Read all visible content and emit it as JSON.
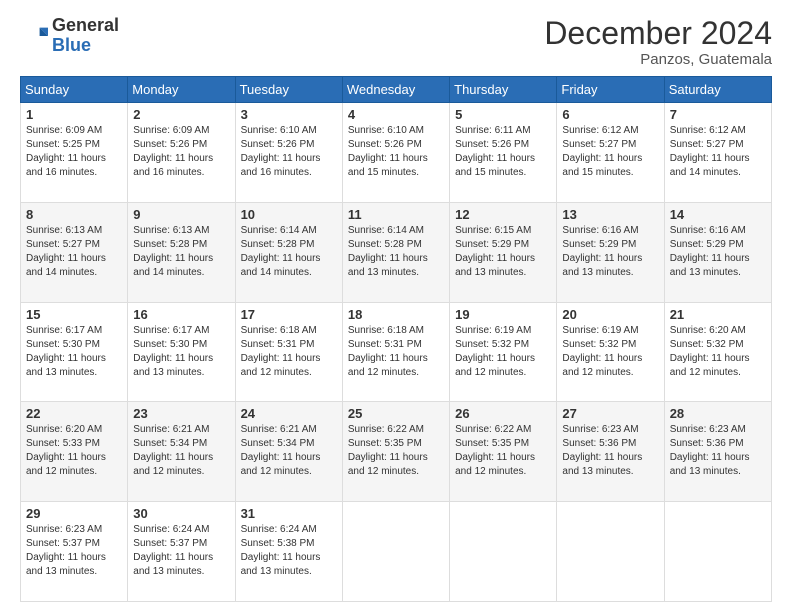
{
  "logo": {
    "general": "General",
    "blue": "Blue"
  },
  "title": "December 2024",
  "subtitle": "Panzos, Guatemala",
  "days_of_week": [
    "Sunday",
    "Monday",
    "Tuesday",
    "Wednesday",
    "Thursday",
    "Friday",
    "Saturday"
  ],
  "weeks": [
    [
      {
        "day": "1",
        "sunrise": "6:09 AM",
        "sunset": "5:25 PM",
        "daylight": "11 hours and 16 minutes."
      },
      {
        "day": "2",
        "sunrise": "6:09 AM",
        "sunset": "5:26 PM",
        "daylight": "11 hours and 16 minutes."
      },
      {
        "day": "3",
        "sunrise": "6:10 AM",
        "sunset": "5:26 PM",
        "daylight": "11 hours and 16 minutes."
      },
      {
        "day": "4",
        "sunrise": "6:10 AM",
        "sunset": "5:26 PM",
        "daylight": "11 hours and 15 minutes."
      },
      {
        "day": "5",
        "sunrise": "6:11 AM",
        "sunset": "5:26 PM",
        "daylight": "11 hours and 15 minutes."
      },
      {
        "day": "6",
        "sunrise": "6:12 AM",
        "sunset": "5:27 PM",
        "daylight": "11 hours and 15 minutes."
      },
      {
        "day": "7",
        "sunrise": "6:12 AM",
        "sunset": "5:27 PM",
        "daylight": "11 hours and 14 minutes."
      }
    ],
    [
      {
        "day": "8",
        "sunrise": "6:13 AM",
        "sunset": "5:27 PM",
        "daylight": "11 hours and 14 minutes."
      },
      {
        "day": "9",
        "sunrise": "6:13 AM",
        "sunset": "5:28 PM",
        "daylight": "11 hours and 14 minutes."
      },
      {
        "day": "10",
        "sunrise": "6:14 AM",
        "sunset": "5:28 PM",
        "daylight": "11 hours and 14 minutes."
      },
      {
        "day": "11",
        "sunrise": "6:14 AM",
        "sunset": "5:28 PM",
        "daylight": "11 hours and 13 minutes."
      },
      {
        "day": "12",
        "sunrise": "6:15 AM",
        "sunset": "5:29 PM",
        "daylight": "11 hours and 13 minutes."
      },
      {
        "day": "13",
        "sunrise": "6:16 AM",
        "sunset": "5:29 PM",
        "daylight": "11 hours and 13 minutes."
      },
      {
        "day": "14",
        "sunrise": "6:16 AM",
        "sunset": "5:29 PM",
        "daylight": "11 hours and 13 minutes."
      }
    ],
    [
      {
        "day": "15",
        "sunrise": "6:17 AM",
        "sunset": "5:30 PM",
        "daylight": "11 hours and 13 minutes."
      },
      {
        "day": "16",
        "sunrise": "6:17 AM",
        "sunset": "5:30 PM",
        "daylight": "11 hours and 13 minutes."
      },
      {
        "day": "17",
        "sunrise": "6:18 AM",
        "sunset": "5:31 PM",
        "daylight": "11 hours and 12 minutes."
      },
      {
        "day": "18",
        "sunrise": "6:18 AM",
        "sunset": "5:31 PM",
        "daylight": "11 hours and 12 minutes."
      },
      {
        "day": "19",
        "sunrise": "6:19 AM",
        "sunset": "5:32 PM",
        "daylight": "11 hours and 12 minutes."
      },
      {
        "day": "20",
        "sunrise": "6:19 AM",
        "sunset": "5:32 PM",
        "daylight": "11 hours and 12 minutes."
      },
      {
        "day": "21",
        "sunrise": "6:20 AM",
        "sunset": "5:32 PM",
        "daylight": "11 hours and 12 minutes."
      }
    ],
    [
      {
        "day": "22",
        "sunrise": "6:20 AM",
        "sunset": "5:33 PM",
        "daylight": "11 hours and 12 minutes."
      },
      {
        "day": "23",
        "sunrise": "6:21 AM",
        "sunset": "5:34 PM",
        "daylight": "11 hours and 12 minutes."
      },
      {
        "day": "24",
        "sunrise": "6:21 AM",
        "sunset": "5:34 PM",
        "daylight": "11 hours and 12 minutes."
      },
      {
        "day": "25",
        "sunrise": "6:22 AM",
        "sunset": "5:35 PM",
        "daylight": "11 hours and 12 minutes."
      },
      {
        "day": "26",
        "sunrise": "6:22 AM",
        "sunset": "5:35 PM",
        "daylight": "11 hours and 12 minutes."
      },
      {
        "day": "27",
        "sunrise": "6:23 AM",
        "sunset": "5:36 PM",
        "daylight": "11 hours and 13 minutes."
      },
      {
        "day": "28",
        "sunrise": "6:23 AM",
        "sunset": "5:36 PM",
        "daylight": "11 hours and 13 minutes."
      }
    ],
    [
      {
        "day": "29",
        "sunrise": "6:23 AM",
        "sunset": "5:37 PM",
        "daylight": "11 hours and 13 minutes."
      },
      {
        "day": "30",
        "sunrise": "6:24 AM",
        "sunset": "5:37 PM",
        "daylight": "11 hours and 13 minutes."
      },
      {
        "day": "31",
        "sunrise": "6:24 AM",
        "sunset": "5:38 PM",
        "daylight": "11 hours and 13 minutes."
      },
      null,
      null,
      null,
      null
    ]
  ]
}
